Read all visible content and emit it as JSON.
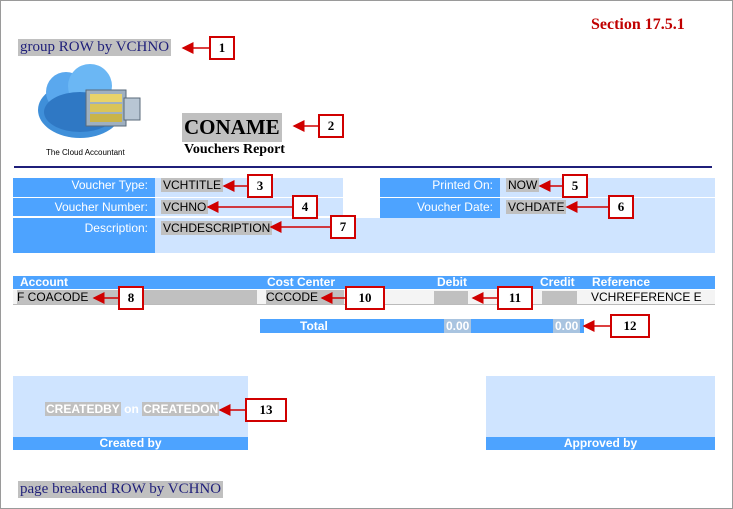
{
  "section": "Section 17.5.1",
  "group_header": "group ROW by VCHNO",
  "logo_text": "The Cloud Accountant",
  "company_name": "CONAME",
  "report_title": "Vouchers Report",
  "fields": {
    "voucher_type_label": "Voucher Type:",
    "voucher_type_value": "VCHTITLE",
    "voucher_number_label": "Voucher Number:",
    "voucher_number_value": "VCHNO",
    "description_label": "Description:",
    "description_value": "VCHDESCRIPTION",
    "printed_on_label": "Printed On:",
    "printed_on_value": "NOW",
    "voucher_date_label": "Voucher Date:",
    "voucher_date_value": "VCHDATE"
  },
  "table": {
    "headers": [
      "Account",
      "Cost Center",
      "Debit",
      "Credit",
      "Reference"
    ],
    "row": {
      "account": "F COACODE",
      "cost_center": "CCCODE",
      "debit": "",
      "credit": "",
      "reference": "VCHREFERENCE E"
    },
    "total_label": "Total",
    "total_debit": "0.00",
    "total_credit": "0.00"
  },
  "signature": {
    "created_by_field": "CREATEDBY",
    "on_word": "on",
    "created_on_field": "CREATEDON",
    "created_by_label": "Created by",
    "approved_by_label": "Approved by"
  },
  "page_break": "page breakend ROW by VCHNO",
  "callouts": [
    "1",
    "2",
    "3",
    "4",
    "5",
    "6",
    "7",
    "8",
    "10",
    "11",
    "12",
    "13"
  ],
  "colors": {
    "accent_blue": "#4da3ff",
    "light_blue": "#cfe4ff",
    "callout_red": "#d00000",
    "divider_navy": "#1f1f7a"
  }
}
